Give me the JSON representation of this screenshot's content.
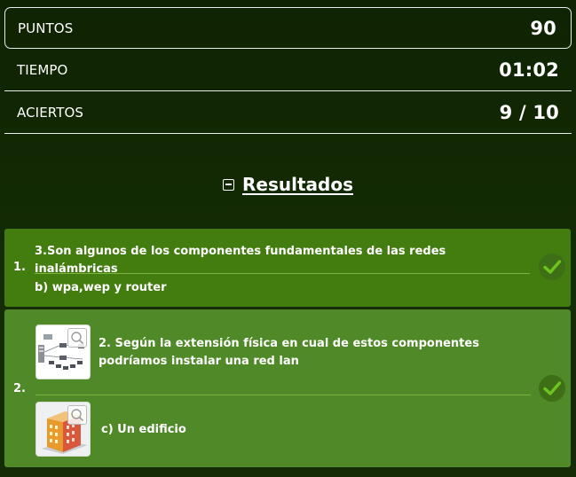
{
  "stats": {
    "points_label": "PUNTOS",
    "points_value": "90",
    "time_label": "TIEMPO",
    "time_value": "01:02",
    "hits_label": "ACIERTOS",
    "hits_value": "9 / 10"
  },
  "results": {
    "title": "Resultados",
    "toggle_icon": "minus-square-icon",
    "items": [
      {
        "number": "1.",
        "question": "3.Son algunos de los componentes fundamentales de las redes inalámbricas",
        "answer": "b) wpa,wep y router",
        "status_icon": "check-icon"
      },
      {
        "number": "2.",
        "question": "2. Según la extensión física en cual de estos componentes podríamos instalar una red lan",
        "answer": "c) Un edificio",
        "status_icon": "check-icon",
        "question_image_icon": "network-diagram-thumbnail",
        "answer_image_icon": "building-thumbnail"
      }
    ]
  },
  "colors": {
    "background": "#0f2302",
    "card_1": "#437c0f",
    "card_2": "#508928",
    "check": "#6cc41f"
  }
}
